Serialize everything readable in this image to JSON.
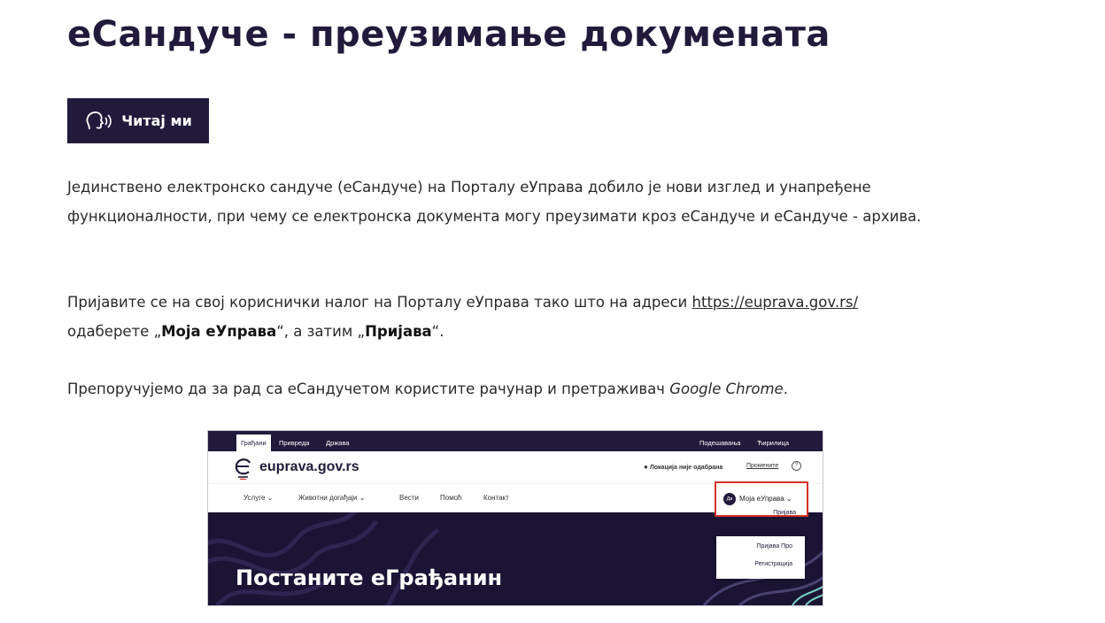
{
  "title": "еСандуче - преузимање докумената",
  "read_button": {
    "label": "Читај ми",
    "icon": "speaker-head-icon"
  },
  "paragraph1": "Јединствено електронско сандуче (еСандуче) на Порталу еУправа добило је нови изглед и унапређене функционалности, при чему се електронска документа могу преузимати кроз еСандуче и еСандуче - архива.",
  "paragraph2": {
    "text_before_link": "Пријавите се на свој кориснички налог на Порталу еУправа тако што на адреси ",
    "link": "https://euprava.gov.rs/",
    "text_after_link": " одаберете „",
    "bold1": "Моја еУправа",
    "middle": "“, а затим „",
    "bold2": "Пријава",
    "end": "“."
  },
  "paragraph3": {
    "text": "Препоручујемо да за рад са еСандучетом користите рачунар и претраживач ",
    "browser": "Google Chrome",
    "end": "."
  },
  "screenshot": {
    "top_tabs": [
      "Грађани",
      "Привреда",
      "Држава"
    ],
    "settings": "Подешавања",
    "script": "Ћирилица",
    "logo": "euprava.gov.rs",
    "location": "Локација није одабрана",
    "change": "Промените",
    "nav": [
      "Услуге",
      "Животни догађаји",
      "Вести",
      "Помоћ",
      "Контакт"
    ],
    "account_label": "Моја еУправа",
    "avatar": "Дв",
    "menu": [
      "Пријава",
      "Пријава Про",
      "Регистрација"
    ],
    "hero_title": "Постаните еГрађанин"
  },
  "colors": {
    "brand": "#221a3b",
    "highlight": "#d93025"
  }
}
